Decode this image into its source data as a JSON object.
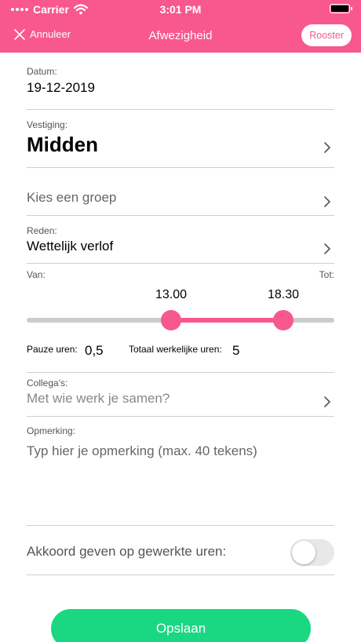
{
  "status_bar": {
    "carrier": "Carrier",
    "time": "3:01 PM"
  },
  "nav": {
    "cancel_label": "Annuleer",
    "title": "Afwezigheid",
    "rooster_label": "Rooster"
  },
  "date": {
    "label": "Datum:",
    "value": "19-12-2019"
  },
  "location": {
    "label": "Vestiging:",
    "value": "Midden"
  },
  "group": {
    "placeholder": "Kies een groep"
  },
  "reason": {
    "label": "Reden:",
    "value": "Wettelijk verlof"
  },
  "time_range": {
    "from_label": "Van:",
    "to_label": "Tot:",
    "start": "13.00",
    "end": "18.30"
  },
  "hours": {
    "pause_label": "Pauze uren:",
    "pause_value": "0,5",
    "total_label": "Totaal werkelijke uren:",
    "total_value": "5"
  },
  "colleagues": {
    "label": "Collega's:",
    "placeholder": "Met wie werk je samen?"
  },
  "remark": {
    "label": "Opmerking:",
    "placeholder": "Typ hier je opmerking (max. 40 tekens)"
  },
  "approve": {
    "label": "Akkoord geven op gewerkte uren:",
    "enabled": false
  },
  "save_label": "Opslaan",
  "colors": {
    "accent": "#f8588d",
    "save": "#1ad782"
  },
  "icons": {
    "cancel": "close-icon",
    "chevron": "chevron-right-icon",
    "wifi": "wifi-icon",
    "battery": "battery-icon"
  }
}
